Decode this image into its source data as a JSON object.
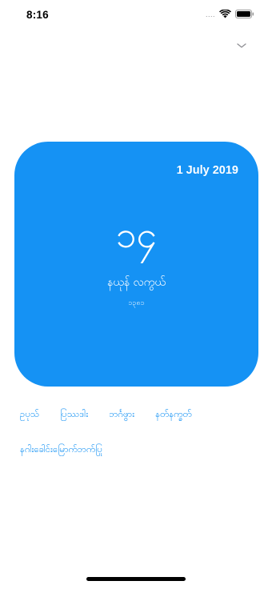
{
  "status_bar": {
    "time": "8:16",
    "signal_dots": "....",
    "icons": [
      "wifi-icon",
      "battery-icon"
    ]
  },
  "header": {
    "toggle_icon": "chevron-down-icon"
  },
  "card": {
    "date": "1 July 2019",
    "day_number": "၁၄",
    "weekday_label": "နယုန် လကွယ်",
    "year_label": "၁၃၈၁",
    "color": "#1592f4"
  },
  "links": {
    "items": [
      {
        "label": "ဥပုသ်"
      },
      {
        "label": "ပြဿဒါး"
      },
      {
        "label": "ဘင်္ဂဖွား"
      },
      {
        "label": "နတ်နက္ခတ်"
      }
    ],
    "extra": "နဂါးခေါင်းမြောက်ဘက်ပြု"
  },
  "accent_color": "#1592f4"
}
